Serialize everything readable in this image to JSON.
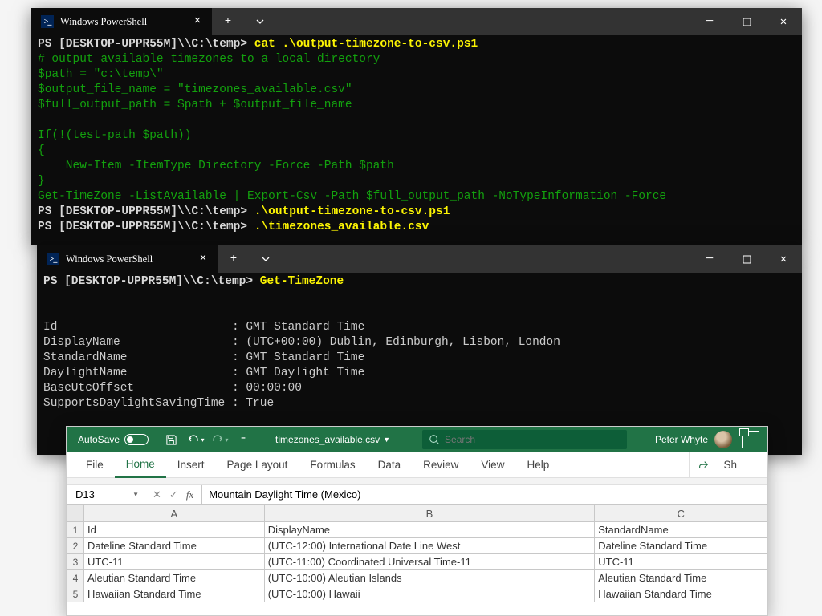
{
  "term": {
    "tab_title": "Windows PowerShell",
    "prompt": "PS [DESKTOP-UPPR55M]\\\\C:\\temp> ",
    "cmd1_a": "cat",
    "cmd1_b": " .\\output-timezone-to-csv.ps1",
    "script": "# output available timezones to a local directory\n$path = \"c:\\temp\\\"\n$output_file_name = \"timezones_available.csv\"\n$full_output_path = $path + $output_file_name\n\nIf(!(test-path $path))\n{\n    New-Item -ItemType Directory -Force -Path $path\n}\nGet-TimeZone -ListAvailable | Export-Csv -Path $full_output_path -NoTypeInformation -Force",
    "cmd2": ".\\output-timezone-to-csv.ps1",
    "cmd3": ".\\timezones_available.csv",
    "cmd4": "Get-TimeZone",
    "out2": "Id                         : GMT Standard Time\nDisplayName                : (UTC+00:00) Dublin, Edinburgh, Lisbon, London\nStandardName               : GMT Standard Time\nDaylightName               : GMT Daylight Time\nBaseUtcOffset              : 00:00:00\nSupportsDaylightSavingTime : True"
  },
  "excel": {
    "autosave": "AutoSave",
    "filename": "timezones_available.csv",
    "search_placeholder": "Search",
    "user": "Peter Whyte",
    "tabs": {
      "file": "File",
      "home": "Home",
      "insert": "Insert",
      "pagelayout": "Page Layout",
      "formulas": "Formulas",
      "data": "Data",
      "review": "Review",
      "view": "View",
      "help": "Help"
    },
    "share": "Sh",
    "namebox": "D13",
    "fx_value": "Mountain Daylight Time (Mexico)",
    "cols": {
      "A": "A",
      "B": "B",
      "C": "C"
    }
  },
  "chart_data": {
    "type": "table",
    "columns": [
      "Id",
      "DisplayName",
      "StandardName"
    ],
    "rows": [
      {
        "Id": "Dateline Standard Time",
        "DisplayName": "(UTC-12:00) International Date Line West",
        "StandardName": "Dateline Standard Time"
      },
      {
        "Id": "UTC-11",
        "DisplayName": "(UTC-11:00) Coordinated Universal Time-11",
        "StandardName": "UTC-11"
      },
      {
        "Id": "Aleutian Standard Time",
        "DisplayName": "(UTC-10:00) Aleutian Islands",
        "StandardName": "Aleutian Standard Time"
      },
      {
        "Id": "Hawaiian Standard Time",
        "DisplayName": "(UTC-10:00) Hawaii",
        "StandardName": "Hawaiian Standard Time"
      }
    ]
  }
}
